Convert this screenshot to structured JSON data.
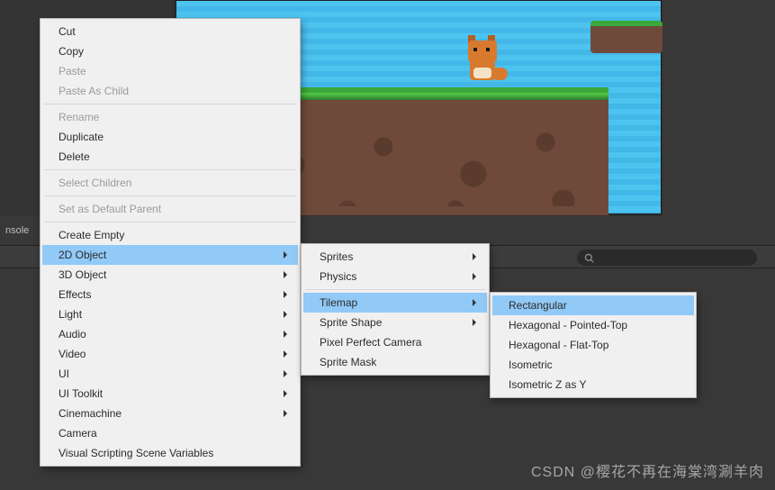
{
  "panel": {
    "label": "nsole"
  },
  "search": {
    "placeholder": ""
  },
  "menu1": {
    "items": [
      {
        "label": "Cut",
        "disabled": false,
        "arrow": false
      },
      {
        "label": "Copy",
        "disabled": false,
        "arrow": false
      },
      {
        "label": "Paste",
        "disabled": true,
        "arrow": false
      },
      {
        "label": "Paste As Child",
        "disabled": true,
        "arrow": false
      },
      {
        "sep": true
      },
      {
        "label": "Rename",
        "disabled": true,
        "arrow": false
      },
      {
        "label": "Duplicate",
        "disabled": false,
        "arrow": false
      },
      {
        "label": "Delete",
        "disabled": false,
        "arrow": false
      },
      {
        "sep": true
      },
      {
        "label": "Select Children",
        "disabled": true,
        "arrow": false
      },
      {
        "sep": true
      },
      {
        "label": "Set as Default Parent",
        "disabled": true,
        "arrow": false
      },
      {
        "sep": true
      },
      {
        "label": "Create Empty",
        "disabled": false,
        "arrow": false
      },
      {
        "label": "2D Object",
        "disabled": false,
        "arrow": true,
        "hl": true
      },
      {
        "label": "3D Object",
        "disabled": false,
        "arrow": true
      },
      {
        "label": "Effects",
        "disabled": false,
        "arrow": true
      },
      {
        "label": "Light",
        "disabled": false,
        "arrow": true
      },
      {
        "label": "Audio",
        "disabled": false,
        "arrow": true
      },
      {
        "label": "Video",
        "disabled": false,
        "arrow": true
      },
      {
        "label": "UI",
        "disabled": false,
        "arrow": true
      },
      {
        "label": "UI Toolkit",
        "disabled": false,
        "arrow": true
      },
      {
        "label": "Cinemachine",
        "disabled": false,
        "arrow": true
      },
      {
        "label": "Camera",
        "disabled": false,
        "arrow": false
      },
      {
        "label": "Visual Scripting Scene Variables",
        "disabled": false,
        "arrow": false
      }
    ]
  },
  "menu2": {
    "items": [
      {
        "label": "Sprites",
        "arrow": true
      },
      {
        "label": "Physics",
        "arrow": true
      },
      {
        "sep": true
      },
      {
        "label": "Tilemap",
        "arrow": true,
        "hl": true
      },
      {
        "label": "Sprite Shape",
        "arrow": true
      },
      {
        "label": "Pixel Perfect Camera",
        "arrow": false
      },
      {
        "label": "Sprite Mask",
        "arrow": false
      }
    ]
  },
  "menu3": {
    "items": [
      {
        "label": "Rectangular",
        "hl": true
      },
      {
        "label": "Hexagonal - Pointed-Top"
      },
      {
        "label": "Hexagonal - Flat-Top"
      },
      {
        "label": "Isometric"
      },
      {
        "label": "Isometric Z as Y"
      }
    ]
  },
  "watermark": "CSDN @樱花不再在海棠湾涮羊肉"
}
